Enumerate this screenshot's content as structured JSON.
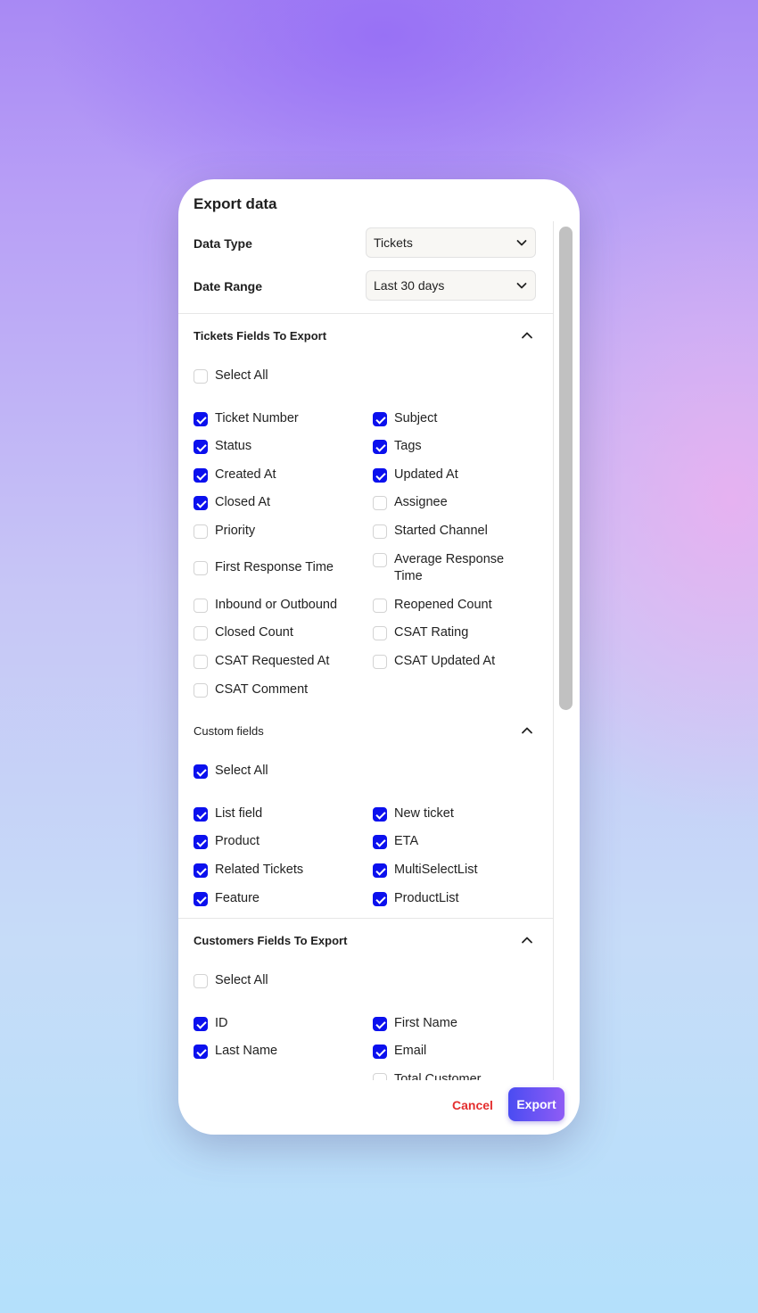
{
  "modal": {
    "title": "Export data",
    "data_type": {
      "label": "Data Type",
      "value": "Tickets"
    },
    "date_range": {
      "label": "Date Range",
      "value": "Last 30 days"
    },
    "tickets_section": {
      "title": "Tickets Fields To Export",
      "select_all": {
        "label": "Select All",
        "checked": false
      },
      "fields": [
        {
          "label": "Ticket Number",
          "checked": true
        },
        {
          "label": "Subject",
          "checked": true
        },
        {
          "label": "Status",
          "checked": true
        },
        {
          "label": "Tags",
          "checked": true
        },
        {
          "label": "Created At",
          "checked": true
        },
        {
          "label": "Updated At",
          "checked": true
        },
        {
          "label": "Closed At",
          "checked": true
        },
        {
          "label": "Assignee",
          "checked": false
        },
        {
          "label": "Priority",
          "checked": false
        },
        {
          "label": "Started Channel",
          "checked": false
        },
        {
          "label": "First Response Time",
          "checked": false
        },
        {
          "label": "Average Response Time",
          "checked": false
        },
        {
          "label": "Inbound or Outbound",
          "checked": false
        },
        {
          "label": "Reopened Count",
          "checked": false
        },
        {
          "label": "Closed Count",
          "checked": false
        },
        {
          "label": "CSAT Rating",
          "checked": false
        },
        {
          "label": "CSAT Requested At",
          "checked": false
        },
        {
          "label": "CSAT Updated At",
          "checked": false
        },
        {
          "label": "CSAT Comment",
          "checked": false
        }
      ]
    },
    "custom_section": {
      "title": "Custom fields",
      "select_all": {
        "label": "Select All",
        "checked": true
      },
      "fields": [
        {
          "label": "List field",
          "checked": true
        },
        {
          "label": "New ticket",
          "checked": true
        },
        {
          "label": "Product",
          "checked": true
        },
        {
          "label": "ETA",
          "checked": true
        },
        {
          "label": "Related Tickets",
          "checked": true
        },
        {
          "label": "MultiSelectList",
          "checked": true
        },
        {
          "label": "Feature",
          "checked": true
        },
        {
          "label": "ProductList",
          "checked": true
        }
      ]
    },
    "customers_section": {
      "title": "Customers Fields To Export",
      "select_all": {
        "label": "Select All",
        "checked": false
      },
      "fields": [
        {
          "label": "ID",
          "checked": true
        },
        {
          "label": "First Name",
          "checked": true
        },
        {
          "label": "Last Name",
          "checked": true
        },
        {
          "label": "Email",
          "checked": true
        },
        {
          "label": "Total Customer",
          "checked": false
        }
      ]
    },
    "cancel_label": "Cancel",
    "export_label": "Export"
  },
  "colors": {
    "checkbox_on": "#0b10ee",
    "cancel": "#e42e2e",
    "export_gradient": [
      "#4a4cf2",
      "#8f5cf5"
    ]
  }
}
